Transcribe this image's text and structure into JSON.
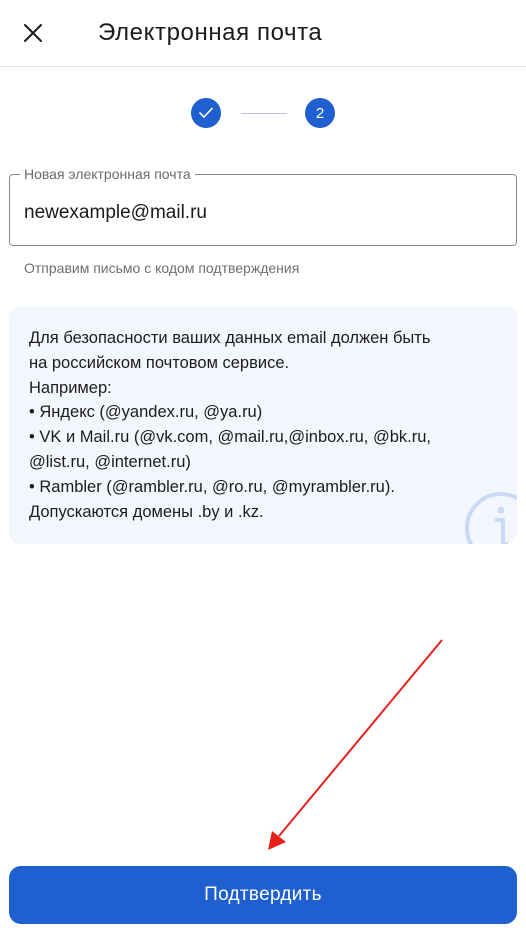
{
  "header": {
    "title": "Электронная почта"
  },
  "stepper": {
    "step1_state": "completed",
    "step2_label": "2"
  },
  "email_field": {
    "label": "Новая электронная почта",
    "value": "newexample@mail.ru",
    "helper": "Отправим письмо с кодом подтверждения"
  },
  "info": {
    "lines": [
      "Для безопасности ваших данных email должен быть",
      "на российском почтовом сервисе.",
      "Например:",
      " • Яндекс (@yandex.ru, @ya.ru)",
      " • VK и Mail.ru (@vk.com, @mail.ru,@inbox.ru, @bk.ru,",
      "@list.ru, @internet.ru)",
      " • Rambler (@rambler.ru, @ro.ru, @myrambler.ru).",
      "Допускаются домены .by и .kz."
    ]
  },
  "submit_button": {
    "label": "Подтвердить"
  },
  "colors": {
    "accent": "#1f5fd0",
    "info_bg": "#f3f7fd",
    "annotation_arrow": "#e8201c"
  },
  "icons": {
    "close": "close-icon",
    "check": "checkmark-icon",
    "info": "info-icon"
  }
}
